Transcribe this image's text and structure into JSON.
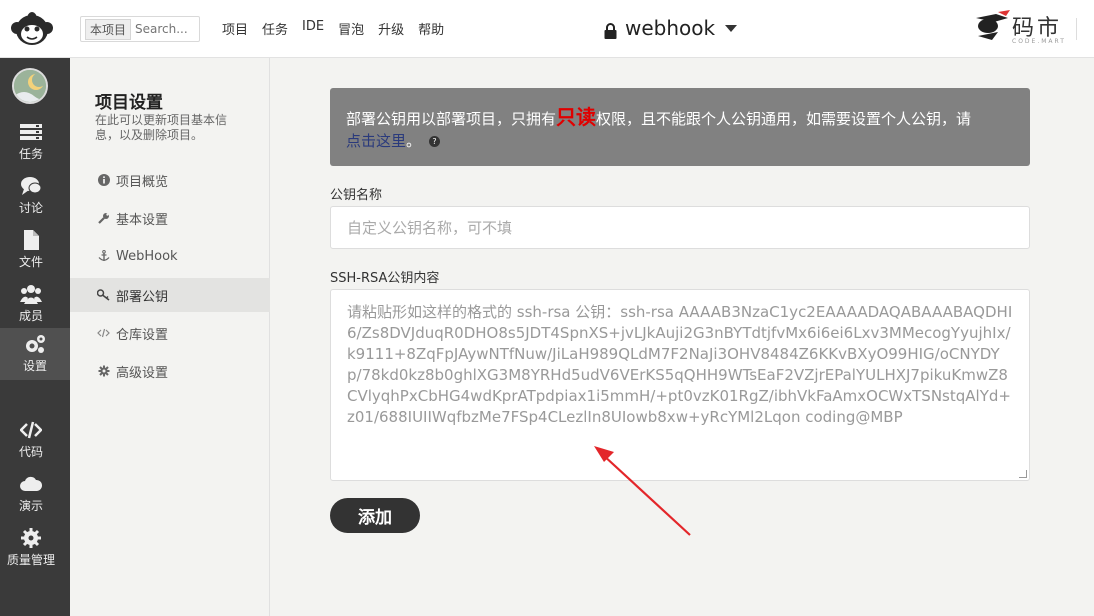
{
  "topbar": {
    "search": {
      "scope": "本项目",
      "placeholder": "Search..."
    },
    "nav": [
      "项目",
      "任务",
      "IDE",
      "冒泡",
      "升级",
      "帮助"
    ],
    "project_name": "webhook",
    "brand": {
      "name": "码市",
      "sub": "CODE.MART"
    }
  },
  "sidebar": {
    "items": [
      {
        "label": "任务",
        "icon": "tasks-icon"
      },
      {
        "label": "讨论",
        "icon": "discussion-icon"
      },
      {
        "label": "文件",
        "icon": "file-icon"
      },
      {
        "label": "成员",
        "icon": "members-icon"
      },
      {
        "label": "设置",
        "icon": "settings-icon",
        "active": true
      },
      {
        "label": "代码",
        "icon": "code-icon"
      },
      {
        "label": "演示",
        "icon": "cloud-icon"
      },
      {
        "label": "质量管理",
        "icon": "quality-icon"
      }
    ]
  },
  "settings": {
    "title": "项目设置",
    "desc": "在此可以更新项目基本信息，以及删除项目。",
    "items": [
      {
        "label": "项目概览",
        "icon": "info-icon"
      },
      {
        "label": "基本设置",
        "icon": "wrench-icon"
      },
      {
        "label": "WebHook",
        "icon": "anchor-icon"
      },
      {
        "label": "部署公钥",
        "icon": "key-icon",
        "active": true
      },
      {
        "label": "仓库设置",
        "icon": "code-icon"
      },
      {
        "label": "高级设置",
        "icon": "cog-icon"
      }
    ]
  },
  "notice": {
    "before": "部署公钥用以部署项目，只拥有",
    "readonly": "只读",
    "after": "权限，且不能跟个人公钥通用，如需要设置个人公钥，请",
    "link": "点击这里",
    "end": "。"
  },
  "form": {
    "name_label": "公钥名称",
    "name_placeholder": "自定义公钥名称，可不填",
    "content_label": "SSH-RSA公钥内容",
    "content_placeholder": "请粘贴形如这样的格式的 ssh-rsa 公钥：ssh-rsa AAAAB3NzaC1yc2EAAAADAQABAAABAQDHI6/Zs8DVJduqR0DHO8s5JDT4SpnXS+jvLJkAuji2G3nBYTdtjfvMx6i6ei6Lxv3MMecogYyujhIx/k9111+8ZqFpJAywNTfNuw/JiLaH989QLdM7F2NaJi3OHV8484Z6KKvBXyO99HIG/oCNYDYp/78kd0kz8b0ghlXG3M8YRHd5udV6VErKS5qQHH9WTsEaF2VZjrEPalYULHXJ7pikuKmwZ8CVlyqhPxCbHG4wdKprATpdpiax1i5mmH/+pt0vzK01RgZ/ibhVkFaAmxOCWxTSNstqAlYd+z01/688IUIIWqfbzMe7FSp4CLezlIn8UIowb8xw+yRcYMl2Lqon coding@MBP",
    "add_button": "添加"
  },
  "colors": {
    "sidebar_bg": "#3a3a3a",
    "notice_bg": "#818181",
    "readonly": "#e00000",
    "button": "#333333"
  }
}
